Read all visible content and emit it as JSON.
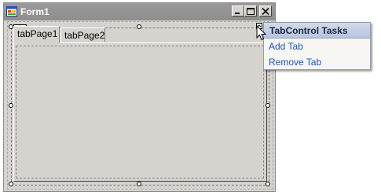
{
  "window": {
    "title": "Form1"
  },
  "tabs": [
    {
      "label": "tabPage1",
      "active": true
    },
    {
      "label": "tabPage2",
      "active": false
    }
  ],
  "tasks_panel": {
    "title": "TabControl Tasks",
    "actions": [
      "Add Tab",
      "Remove Tab"
    ]
  },
  "icons": [
    "form-icon",
    "minimize-icon",
    "maximize-icon",
    "close-icon",
    "move-icon",
    "smart-tag-icon",
    "cursor-icon"
  ]
}
